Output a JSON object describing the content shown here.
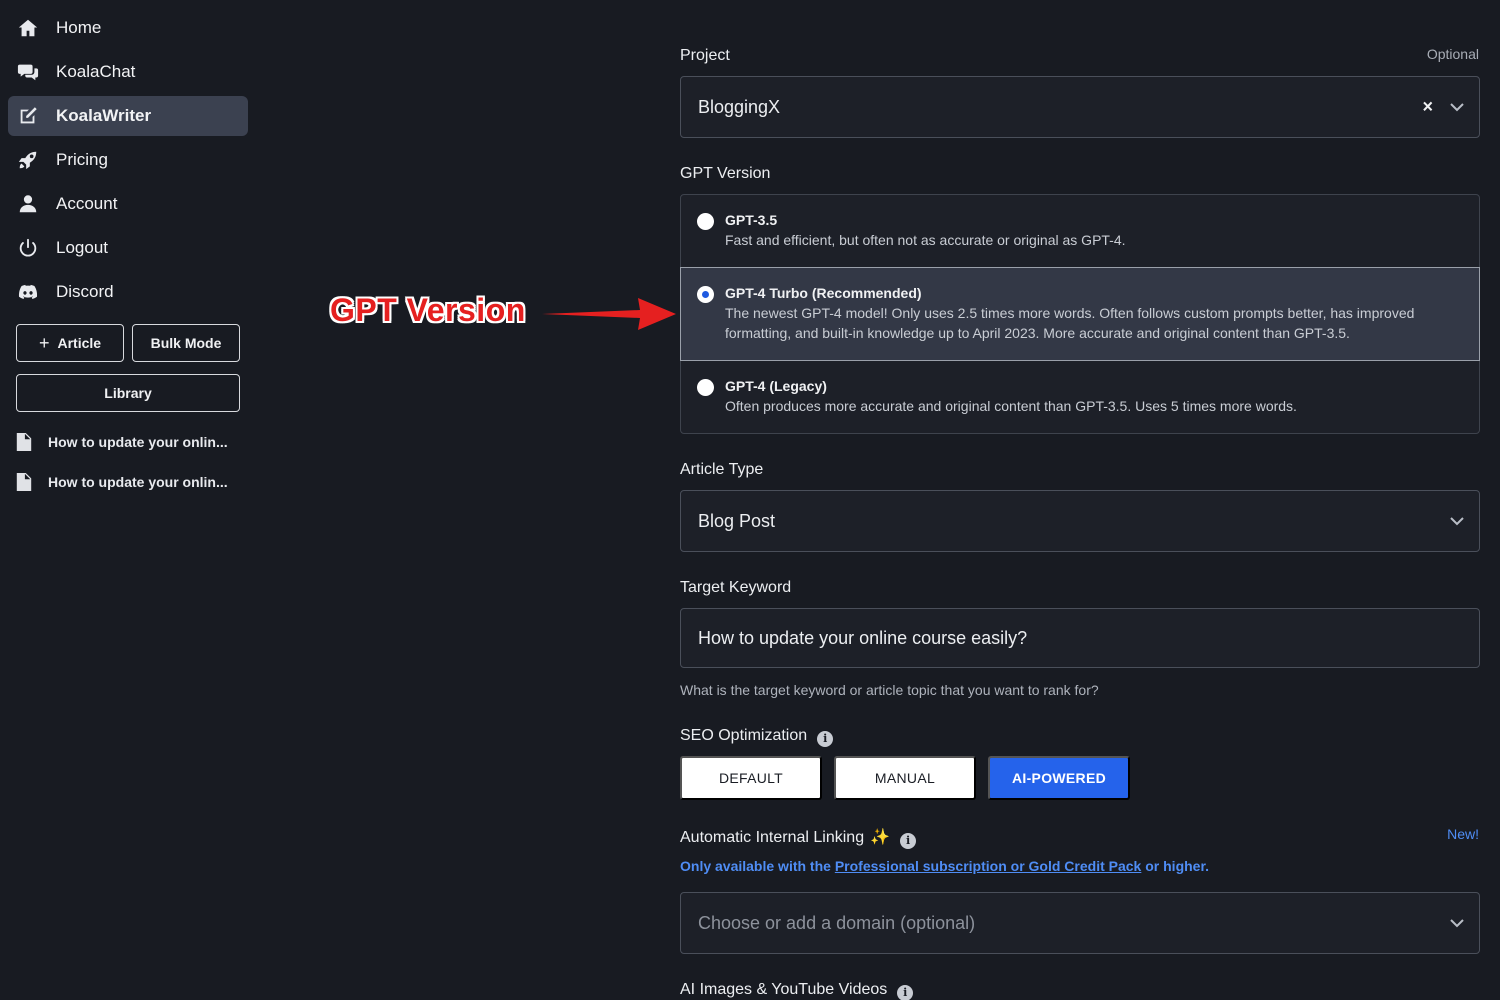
{
  "sidebar": {
    "items": [
      {
        "label": "Home",
        "icon": "home-icon"
      },
      {
        "label": "KoalaChat",
        "icon": "chat-icon"
      },
      {
        "label": "KoalaWriter",
        "icon": "edit-icon",
        "active": true
      },
      {
        "label": "Pricing",
        "icon": "rocket-icon"
      },
      {
        "label": "Account",
        "icon": "user-icon"
      },
      {
        "label": "Logout",
        "icon": "power-icon"
      },
      {
        "label": "Discord",
        "icon": "discord-icon"
      }
    ],
    "article_button": "Article",
    "article_plus": "+",
    "bulk_mode_button": "Bulk Mode",
    "library_button": "Library",
    "recent": [
      "How to update your onlin...",
      "How to update your onlin..."
    ]
  },
  "annotation": {
    "text": "GPT Version",
    "color": "#e52020"
  },
  "form": {
    "project": {
      "label": "Project",
      "optional": "Optional",
      "value": "BloggingX",
      "clear": "×"
    },
    "gpt_version": {
      "label": "GPT Version",
      "selected": 1,
      "options": [
        {
          "title": "GPT-3.5",
          "desc": "Fast and efficient, but often not as accurate or original as GPT-4."
        },
        {
          "title": "GPT-4 Turbo (Recommended)",
          "desc": "The newest GPT-4 model! Only uses 2.5 times more words. Often follows custom prompts better, has improved formatting, and built-in knowledge up to April 2023. More accurate and original content than GPT-3.5."
        },
        {
          "title": "GPT-4 (Legacy)",
          "desc": "Often produces more accurate and original content than GPT-3.5. Uses 5 times more words."
        }
      ]
    },
    "article_type": {
      "label": "Article Type",
      "value": "Blog Post"
    },
    "target_keyword": {
      "label": "Target Keyword",
      "value": "How to update your online course easily?",
      "help": "What is the target keyword or article topic that you want to rank for?"
    },
    "seo": {
      "label": "SEO Optimization",
      "info": "i",
      "options": [
        "DEFAULT",
        "MANUAL",
        "AI-POWERED"
      ],
      "selected": "AI-POWERED"
    },
    "internal_linking": {
      "label": "Automatic Internal Linking",
      "sparkle": "✨",
      "info": "i",
      "badge": "New!",
      "avail_prefix": "Only available with the ",
      "avail_link": "Professional subscription or Gold Credit Pack",
      "avail_suffix": " or higher.",
      "placeholder": "Choose or add a domain (optional)"
    },
    "ai_images": {
      "label": "AI Images & YouTube Videos",
      "info": "i"
    }
  },
  "colors": {
    "background": "#181b22",
    "accent": "#2563eb",
    "link": "#4f8df5"
  }
}
